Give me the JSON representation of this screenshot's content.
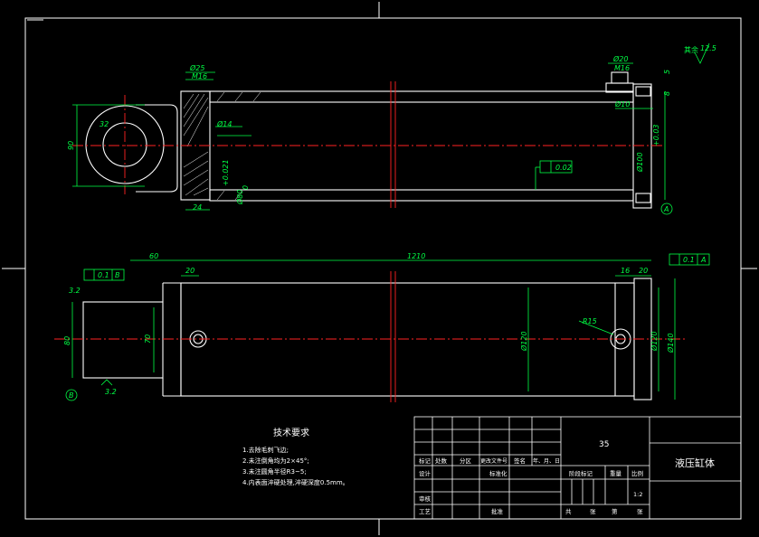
{
  "tech_req": {
    "title": "技术要求",
    "items": [
      "1.去除毛刺飞边;",
      "2.未注倒角均为2×45°;",
      "3.未注圆角半径R3~5;",
      "4.内表面淬硬处理,淬硬深度0.5mm。"
    ]
  },
  "title_block": {
    "material": "35",
    "part_name": "液压缸体",
    "scale": "1:2",
    "scale_label": "比例",
    "weight_label": "重量",
    "stage_label": "阶段标记",
    "headers": [
      "标记",
      "处数",
      "分区",
      "更改文件号",
      "签名",
      "年、月、日"
    ],
    "design": "设计",
    "standard": "标准化",
    "check": "审核",
    "craft": "工艺",
    "approve": "批准",
    "total": "共",
    "sheet": "张",
    "of": "第",
    "sheet2": "张"
  },
  "top_view": {
    "dims": {
      "d25": "Ø25",
      "m16": "M16",
      "d20": "Ø20",
      "m16b": "M16",
      "d14": "Ø14",
      "d80": "Ø80",
      "tol_plus": "+0.021",
      "tol_zero": "0",
      "d10": "Ø10",
      "d100": "Ø100",
      "d100_tol": "+0.03",
      "h90": "90",
      "r32": "32",
      "w24": "24",
      "d5": "5",
      "d8": "8",
      "flatness": "0.02",
      "datum_a": "A",
      "surface_note": "其余",
      "surface_value": "12.5"
    }
  },
  "bottom_view": {
    "dims": {
      "d60": "60",
      "d1210": "1210",
      "d20": "20",
      "d16": "16",
      "d20b": "20",
      "h80": "80",
      "h70": "70",
      "d120": "Ø120",
      "d120b": "Ø120",
      "d140": "Ø140",
      "r15": "R15",
      "rough32": "3.2",
      "rough32b": "3.2",
      "tol01": "0.1",
      "datum_b": "B",
      "tol01b": "0.1",
      "datum_a2": "A"
    }
  }
}
